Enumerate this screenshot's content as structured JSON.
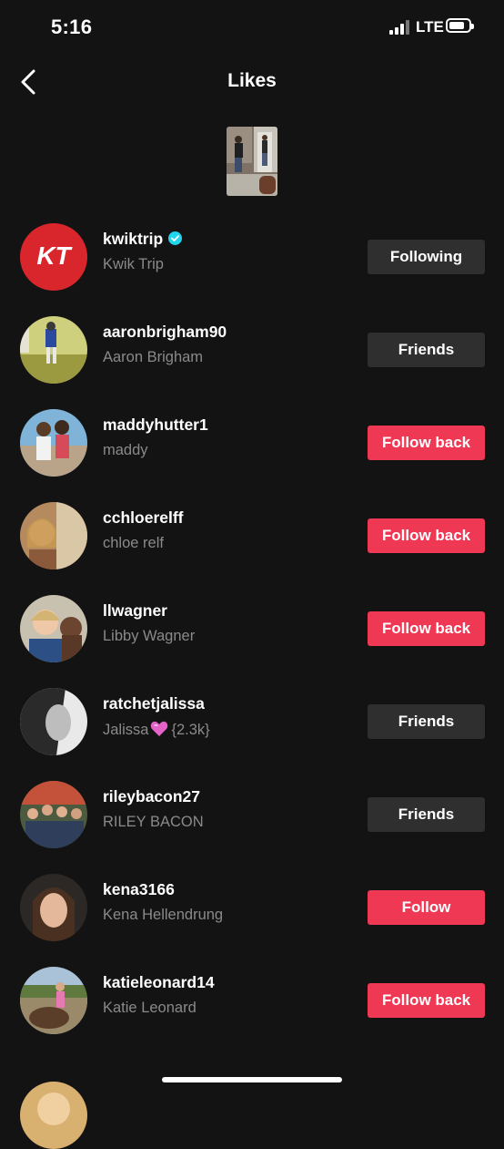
{
  "status_bar": {
    "time": "5:16",
    "network": "LTE",
    "battery_level": 0.8
  },
  "header": {
    "title": "Likes",
    "back_icon": "chevron-left-icon"
  },
  "colors": {
    "background": "#131313",
    "primary_button": "#ee3854",
    "secondary_button": "#2f2f2f",
    "verified": "#20d5ec",
    "secondary_text": "#8a8a8c"
  },
  "likes": [
    {
      "username": "kwiktrip",
      "display_name": "Kwik Trip",
      "verified": true,
      "button": "Following",
      "button_style": "gray"
    },
    {
      "username": "aaronbrigham90",
      "display_name": "Aaron Brigham",
      "button": "Friends",
      "button_style": "gray"
    },
    {
      "username": "maddyhutter1",
      "display_name": "maddy",
      "button": "Follow back",
      "button_style": "red"
    },
    {
      "username": "cchloerelff",
      "display_name": "chloe relf",
      "button": "Follow back",
      "button_style": "red"
    },
    {
      "username": "llwagner",
      "display_name": "Libby Wagner",
      "button": "Follow back",
      "button_style": "red"
    },
    {
      "username": "ratchetjalissa",
      "display_name_prefix": "Jalissa",
      "display_name_suffix": "{2.3k}",
      "button": "Friends",
      "button_style": "gray"
    },
    {
      "username": "rileybacon27",
      "display_name": "RILEY BACON",
      "button": "Friends",
      "button_style": "gray"
    },
    {
      "username": "kena3166",
      "display_name": "Kena Hellendrung",
      "button": "Follow",
      "button_style": "red"
    },
    {
      "username": "katieleonard14",
      "display_name": "Katie Leonard",
      "button": "Follow back",
      "button_style": "red"
    }
  ]
}
